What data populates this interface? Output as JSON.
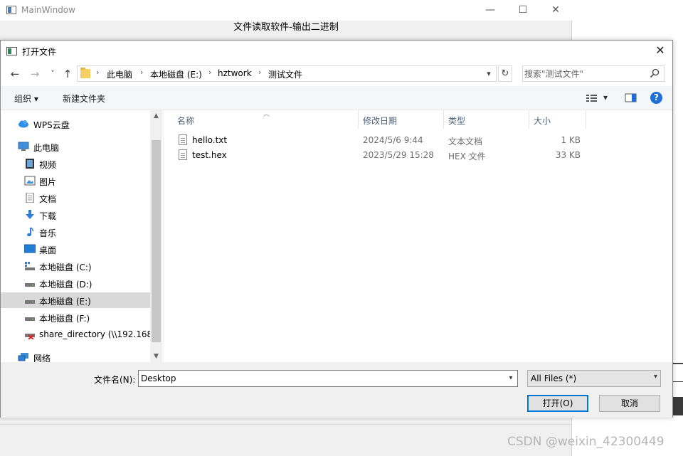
{
  "main_window": {
    "title": "MainWindow",
    "heading": "文件读取软件-输出二进制",
    "controls": {
      "minimize": "—",
      "maximize": "☐",
      "close": "✕"
    }
  },
  "dialog": {
    "title": "打开文件",
    "close": "✕",
    "nav": {
      "back": "←",
      "forward": "→",
      "recent": "˅",
      "up": "↑"
    },
    "breadcrumb": [
      "此电脑",
      "本地磁盘 (E:)",
      "hztwork",
      "测试文件"
    ],
    "breadcrumb_sep": "›",
    "refresh": "↻",
    "search": {
      "placeholder": "搜索\"测试文件\""
    },
    "toolbar": {
      "organize": "组织 ▾",
      "new_folder": "新建文件夹",
      "view_menu": "▾",
      "help": "?"
    },
    "sidebar": [
      {
        "label": "WPS云盘",
        "icon": "cloud-icon"
      },
      {
        "label": "此电脑",
        "icon": "computer-icon"
      },
      {
        "label": "视频",
        "icon": "video-icon"
      },
      {
        "label": "图片",
        "icon": "picture-icon"
      },
      {
        "label": "文档",
        "icon": "document-icon"
      },
      {
        "label": "下载",
        "icon": "download-icon"
      },
      {
        "label": "音乐",
        "icon": "music-icon"
      },
      {
        "label": "桌面",
        "icon": "desktop-icon"
      },
      {
        "label": "本地磁盘 (C:)",
        "icon": "drive-icon"
      },
      {
        "label": "本地磁盘 (D:)",
        "icon": "drive-icon"
      },
      {
        "label": "本地磁盘 (E:)",
        "icon": "drive-icon",
        "selected": true
      },
      {
        "label": "本地磁盘 (F:)",
        "icon": "drive-icon"
      },
      {
        "label": "share_directory (\\\\192.168.",
        "icon": "network-drive-icon"
      },
      {
        "label": "网络",
        "icon": "network-icon"
      }
    ],
    "columns": [
      "名称",
      "修改日期",
      "类型",
      "大小"
    ],
    "files": [
      {
        "name": "hello.txt",
        "modified": "2024/5/6 9:44",
        "type": "文本文档",
        "size": "1 KB"
      },
      {
        "name": "test.hex",
        "modified": "2023/5/29 15:28",
        "type": "HEX 文件",
        "size": "33 KB"
      }
    ],
    "filename_label": "文件名(N):",
    "filename_value": "Desktop",
    "filter": "All Files (*)",
    "open_button": "打开(O)",
    "cancel_button": "取消"
  },
  "watermark": "CSDN @weixin_42300449",
  "colors": {
    "accent": "#0078d7",
    "selected_nav": "#d9d9d9",
    "header_text": "#4c607a"
  }
}
